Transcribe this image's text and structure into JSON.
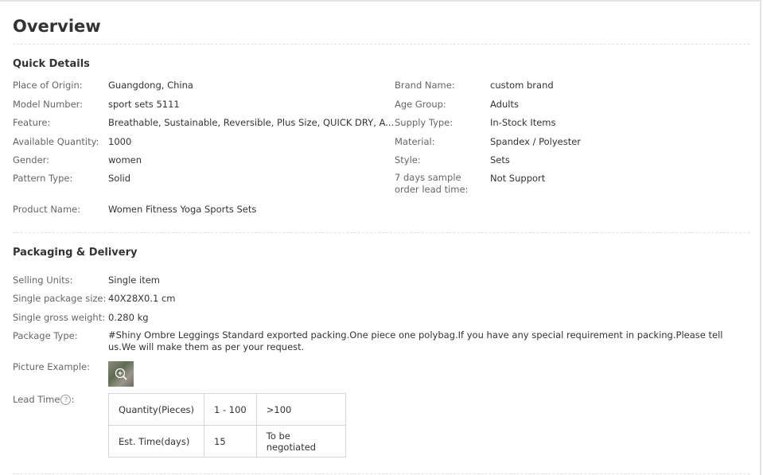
{
  "overview": {
    "title": "Overview"
  },
  "quick_details": {
    "title": "Quick Details",
    "left": [
      {
        "label": "Place of Origin:",
        "value": "Guangdong, China"
      },
      {
        "label": "Model Number:",
        "value": "sport sets 5111"
      },
      {
        "label": "Feature:",
        "value": "Breathable, Sustainable, Reversible, Plus Size, QUICK DRY, A..."
      },
      {
        "label": "Available Quantity:",
        "value": "1000"
      },
      {
        "label": "Gender:",
        "value": "women"
      },
      {
        "label": "Pattern Type:",
        "value": "Solid"
      },
      {
        "label": "Product Name:",
        "value": "Women Fitness Yoga Sports Sets"
      }
    ],
    "right": [
      {
        "label": "Brand Name:",
        "value": "custom brand"
      },
      {
        "label": "Age Group:",
        "value": "Adults"
      },
      {
        "label": "Supply Type:",
        "value": "In-Stock Items"
      },
      {
        "label": "Material:",
        "value": "Spandex / Polyester"
      },
      {
        "label": "Style:",
        "value": "Sets"
      },
      {
        "label": "7 days sample order lead time:",
        "value": "Not Support"
      }
    ]
  },
  "packaging": {
    "title": "Packaging & Delivery",
    "rows": [
      {
        "label": "Selling Units:",
        "value": "Single item"
      },
      {
        "label": "Single package size:",
        "value": "40X28X0.1 cm"
      },
      {
        "label": "Single gross weight:",
        "value": "0.280 kg"
      },
      {
        "label": "Package Type:",
        "value": "#Shiny Ombre Leggings Standard exported packing.One piece one polybag.If you have any special requirement in packing.Please tell us.We will make them as per your request."
      }
    ],
    "picture_label": "Picture Example:",
    "picture_icon": "zoom-in-icon",
    "lead_label": "Lead Time",
    "lead_help_glyph": "?",
    "lead_colon": ":",
    "lead_table": {
      "header": [
        "Quantity(Pieces)",
        "1 - 100",
        ">100"
      ],
      "row": [
        "Est. Time(days)",
        "15",
        "To be negotiated"
      ]
    }
  }
}
